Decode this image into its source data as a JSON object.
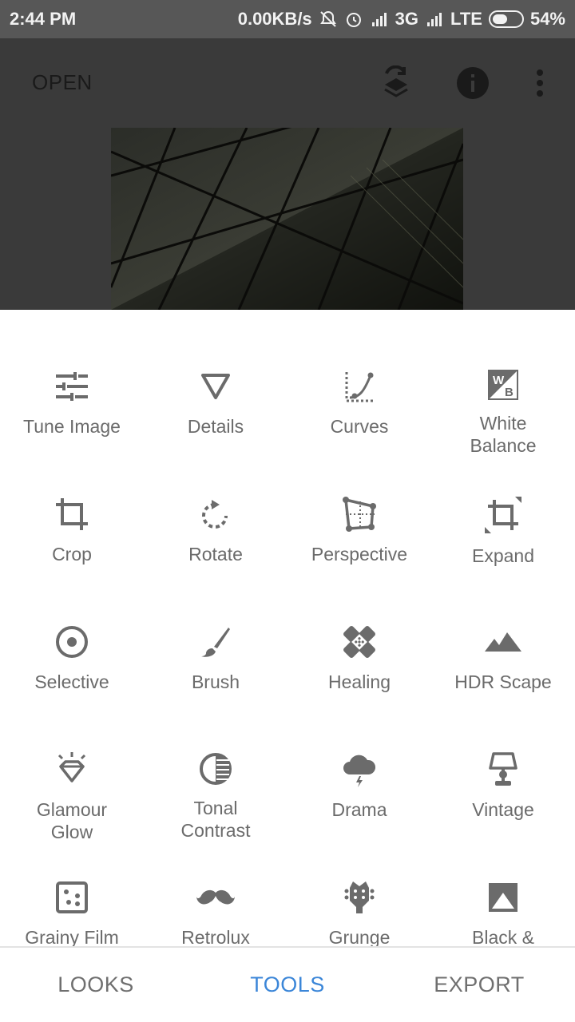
{
  "status_bar": {
    "time": "2:44 PM",
    "net_speed": "0.00KB/s",
    "network1": "3G",
    "network2": "LTE",
    "battery": "54%",
    "battery_level": 0.54
  },
  "editor": {
    "open_label": "OPEN",
    "icons": [
      "layers-swap-icon",
      "info-icon",
      "more-vert-icon"
    ]
  },
  "tools": [
    {
      "label": "Tune Image",
      "icon": "tune-icon"
    },
    {
      "label": "Details",
      "icon": "details-triangle-icon"
    },
    {
      "label": "Curves",
      "icon": "curves-icon"
    },
    {
      "label": "White\nBalance",
      "icon": "white-balance-icon"
    },
    {
      "label": "Crop",
      "icon": "crop-icon"
    },
    {
      "label": "Rotate",
      "icon": "rotate-icon"
    },
    {
      "label": "Perspective",
      "icon": "perspective-icon"
    },
    {
      "label": "Expand",
      "icon": "expand-icon"
    },
    {
      "label": "Selective",
      "icon": "selective-icon"
    },
    {
      "label": "Brush",
      "icon": "brush-icon"
    },
    {
      "label": "Healing",
      "icon": "healing-icon"
    },
    {
      "label": "HDR Scape",
      "icon": "hdr-mountains-icon"
    },
    {
      "label": "Glamour\nGlow",
      "icon": "glamour-diamond-icon"
    },
    {
      "label": "Tonal\nContrast",
      "icon": "tonal-contrast-icon"
    },
    {
      "label": "Drama",
      "icon": "drama-cloud-icon"
    },
    {
      "label": "Vintage",
      "icon": "vintage-lamp-icon"
    },
    {
      "label": "Grainy Film",
      "icon": "grainy-film-icon"
    },
    {
      "label": "Retrolux",
      "icon": "mustache-icon"
    },
    {
      "label": "Grunge",
      "icon": "grunge-guitar-icon"
    },
    {
      "label": "Black &",
      "icon": "black-white-icon"
    }
  ],
  "bottom_nav": {
    "looks": "LOOKS",
    "tools": "TOOLS",
    "export": "EXPORT",
    "active_color": "#3b86d8"
  }
}
